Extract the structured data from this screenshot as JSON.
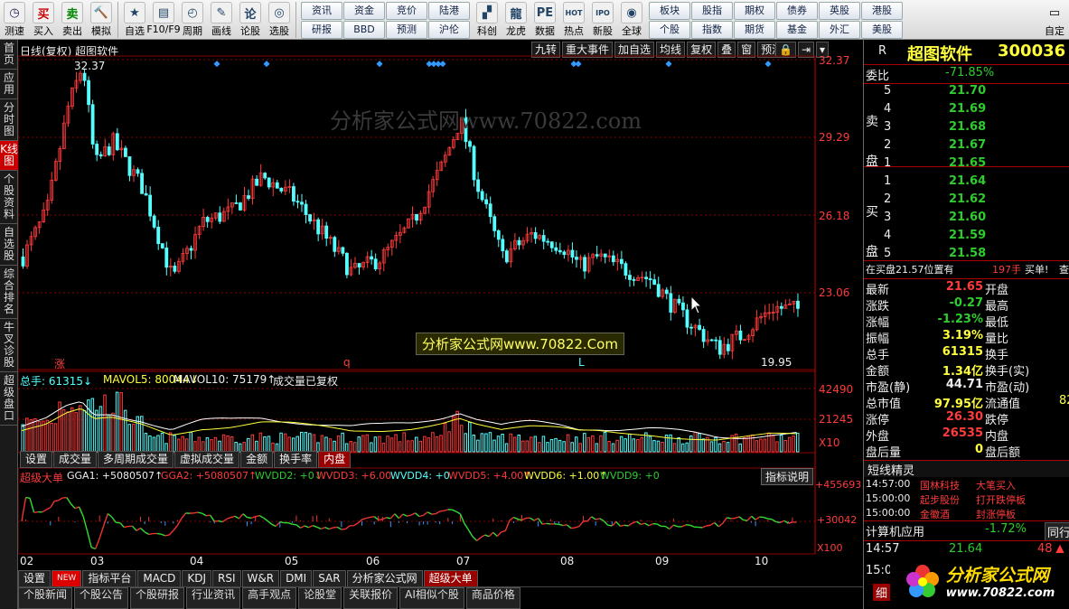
{
  "toolbar": {
    "left_buttons": [
      {
        "label": "测速",
        "icon": "clock-icon",
        "color": "#225"
      },
      {
        "label": "买入",
        "icon": "buy-icon",
        "color": "#c00"
      },
      {
        "label": "卖出",
        "icon": "sell-icon",
        "color": "#080"
      },
      {
        "label": "模拟",
        "icon": "hammer-icon",
        "color": "#a60"
      }
    ],
    "mid_buttons": [
      {
        "label": "自选",
        "icon": "star-icon"
      },
      {
        "label": "F10/F9",
        "icon": "f10-icon"
      },
      {
        "label": "周期",
        "icon": "period-icon"
      },
      {
        "label": "画线",
        "icon": "pen-icon"
      },
      {
        "label": "论股",
        "icon": "discuss-icon"
      },
      {
        "label": "选股",
        "icon": "select-icon"
      }
    ],
    "grid1": [
      "资讯",
      "资金",
      "竞价",
      "陆港",
      "研报",
      "BBD",
      "预测",
      "沪伦"
    ],
    "mid_buttons2": [
      {
        "label": "科创",
        "icon": "kechuang-icon"
      },
      {
        "label": "龙虎",
        "icon": "dragon-icon"
      },
      {
        "label": "数据",
        "icon": "pe-icon"
      },
      {
        "label": "热点",
        "icon": "hot-icon"
      },
      {
        "label": "新股",
        "icon": "ipo-icon"
      },
      {
        "label": "全球",
        "icon": "globe-icon"
      }
    ],
    "grid2": [
      "板块",
      "股指",
      "期权",
      "债券",
      "英股",
      "港股",
      "个股",
      "指数",
      "期货",
      "基金",
      "外汇",
      "美股"
    ],
    "right_button": {
      "label": "自定",
      "icon": "window-icon"
    }
  },
  "leftnav": [
    "首页",
    "应用",
    "分时图",
    "K线图",
    "个股资料",
    "自选股",
    "综合排名",
    "牛叉诊股",
    "超级盘口"
  ],
  "leftnav_active": 3,
  "kline": {
    "title": "日线(复权) 超图软件",
    "menu": [
      "九转",
      "重大事件",
      "加自选",
      "均线",
      "复权",
      "叠",
      "窗",
      "预测"
    ],
    "y_ticks": [
      "32.37",
      "29.29",
      "26.18",
      "23.06"
    ],
    "high_label": "32.37",
    "low_label": "19.95",
    "marker_labels": [
      "涨",
      "q",
      "L"
    ],
    "watermark_top": "分析家公式网www.70822.com",
    "watermark_box": "分析家公式网www.70822.Com"
  },
  "volume": {
    "label_total": "总手: 61315↓",
    "label_ma5": "MAVOL5: 80044↓",
    "label_ma10": "MAVOL10: 75179↑",
    "label_note": "成交量已复权",
    "y_ticks": [
      "42490",
      "21245",
      "X10"
    ],
    "tabs": [
      "设置",
      "成交量",
      "多周期成交量",
      "虚拟成交量",
      "金额",
      "换手率",
      "内盘"
    ],
    "active_tab": "内盘"
  },
  "indicator": {
    "name": "超级大单",
    "gga1": "GGA1: +5080507↑",
    "gga2": "GGA2: +5080507↑",
    "wvdd2": "WVDD2: +0↓",
    "wvdd3": "WVDD3: +6.00",
    "wvdd4": "WVDD4: +0",
    "wvdd5": "WVDD5: +4.00↑",
    "wvdd6": "WVDD6: +1.00↑",
    "wvdd9": "WVDD9: +0",
    "help": "指标说明",
    "y_ticks": [
      "+455693",
      "+30042",
      "X100"
    ]
  },
  "x_axis": [
    "02",
    "03",
    "04",
    "05",
    "06",
    "07",
    "08",
    "09",
    "10"
  ],
  "indicator_tabs": [
    "设置",
    "NEW",
    "指标平台",
    "MACD",
    "KDJ",
    "RSI",
    "W&R",
    "DMI",
    "SAR",
    "分析家公式网",
    "超级大单"
  ],
  "bottom_tabs": [
    "个股新闻",
    "个股公告",
    "个股研报",
    "行业资讯",
    "高手观点",
    "论股堂",
    "关联报价",
    "AI相似个股",
    "商品价格"
  ],
  "stock": {
    "market": "R",
    "name": "超图软件",
    "code": "300036",
    "weibi_label": "委比",
    "weibi": "-71.85%",
    "sell_label": "卖盘",
    "buy_label": "买盘",
    "sell": [
      {
        "n": "5",
        "p": "21.70"
      },
      {
        "n": "4",
        "p": "21.69"
      },
      {
        "n": "3",
        "p": "21.68"
      },
      {
        "n": "2",
        "p": "21.67"
      },
      {
        "n": "1",
        "p": "21.65"
      }
    ],
    "buy": [
      {
        "n": "1",
        "p": "21.64"
      },
      {
        "n": "2",
        "p": "21.62"
      },
      {
        "n": "3",
        "p": "21.60"
      },
      {
        "n": "4",
        "p": "21.59"
      },
      {
        "n": "5",
        "p": "21.58"
      }
    ],
    "alert": "在买盘21.57位置有",
    "alert_qty": "197手",
    "alert_tag": "买单!",
    "alert_more": "查",
    "quote": [
      {
        "k": "最新",
        "v": "21.65",
        "c": "#ff3b3b",
        "k2": "开盘"
      },
      {
        "k": "涨跌",
        "v": "-0.27",
        "c": "#2ecc2e",
        "k2": "最高"
      },
      {
        "k": "涨幅",
        "v": "-1.23%",
        "c": "#2ecc2e",
        "k2": "最低"
      },
      {
        "k": "振幅",
        "v": "3.19%",
        "c": "#ffff3c",
        "k2": "量比"
      },
      {
        "k": "总手",
        "v": "61315",
        "c": "#ffff3c",
        "k2": "换手"
      },
      {
        "k": "金额",
        "v": "1.34亿",
        "c": "#ffff3c",
        "k2": "换手(实)"
      },
      {
        "k": "市盈(静)",
        "v": "44.71",
        "c": "#eeeeee",
        "k2": "市盈(动)"
      },
      {
        "k": "总市值",
        "v": "97.95亿",
        "c": "#ffff3c",
        "k2": "流通值",
        "v2": "82"
      },
      {
        "k": "涨停",
        "v": "26.30",
        "c": "#ff3b3b",
        "k2": "跌停"
      },
      {
        "k": "外盘",
        "v": "26535",
        "c": "#ff3b3b",
        "k2": "内盘"
      },
      {
        "k": "盘后量",
        "v": "0",
        "c": "#ffff3c",
        "k2": "盘后额"
      }
    ],
    "news_title": "短线精灵",
    "news": [
      {
        "t": "14:57:00",
        "name": "国林科技",
        "ev": "大笔买入"
      },
      {
        "t": "15:00:00",
        "name": "起步股份",
        "ev": "打开跌停板"
      },
      {
        "t": "15:00:00",
        "name": "金徽酒",
        "ev": "封涨停板"
      }
    ],
    "app_label": "计算机应用",
    "app_val": "-1.72%",
    "app_more": "同行",
    "tick_time": "14:57",
    "tick_price": "21.64",
    "tick_vol": "48",
    "tick_time2": "15:0",
    "tail_tab": "细"
  },
  "logo": {
    "text": "分析家公式网",
    "url": "www.70822.com"
  },
  "colors": {
    "up": "#ff3b3b",
    "down": "#54ffff",
    "grid": "#8a0000",
    "ma5": "#ffffff",
    "ma10": "#ffff3c"
  }
}
